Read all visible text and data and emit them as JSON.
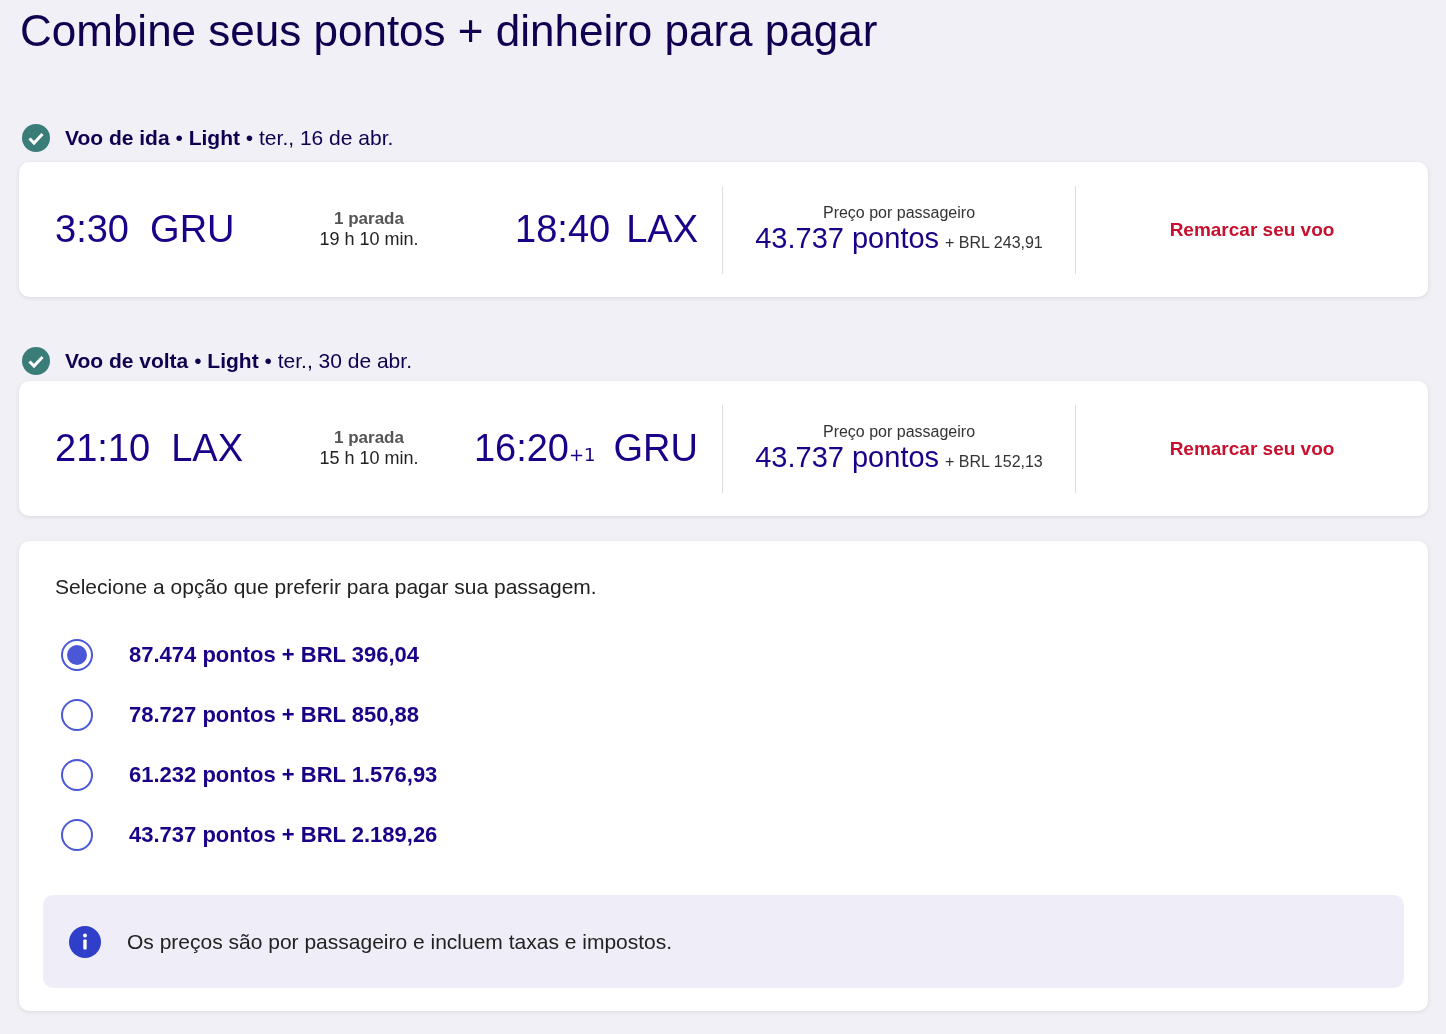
{
  "title": "Combine seus pontos + dinheiro para pagar",
  "flights": [
    {
      "header": {
        "direction": "Voo de ida",
        "separator_1": "•",
        "fare": "Light",
        "separator_2": "•",
        "date": "ter., 16 de abr.",
        "confirmed": true
      },
      "dep_time": "3:30",
      "dep_airport": "GRU",
      "stops": "1 parada",
      "duration": "19 h 10 min.",
      "arr_time": "18:40",
      "arr_airport": "LAX",
      "price_label": "Preço por passageiro",
      "points": "43.737 pontos",
      "cash": "+ BRL 243,91",
      "action": "Remarcar seu voo"
    },
    {
      "header": {
        "direction": "Voo de volta",
        "separator_1": "•",
        "fare": "Light",
        "separator_2": "•",
        "date": "ter., 30 de abr.",
        "confirmed": true
      },
      "dep_time": "21:10",
      "dep_airport": "LAX",
      "stops": "1 parada",
      "duration": "15 h 10 min.",
      "arr_time": "16:20",
      "arr_offset": "+1",
      "arr_airport": "GRU",
      "price_label": "Preço por passageiro",
      "points": "43.737 pontos",
      "cash": "+ BRL 152,13",
      "action": "Remarcar seu voo"
    }
  ],
  "payment": {
    "prompt": "Selecione a opção que preferir para pagar sua passagem.",
    "options": [
      {
        "label": "87.474 pontos + BRL 396,04",
        "selected": true
      },
      {
        "label": "78.727 pontos + BRL 850,88",
        "selected": false
      },
      {
        "label": "61.232 pontos + BRL 1.576,93",
        "selected": false
      },
      {
        "label": "43.737 pontos + BRL 2.189,26",
        "selected": false
      }
    ],
    "info": "Os preços são por passageiro e incluem taxas e impostos."
  }
}
